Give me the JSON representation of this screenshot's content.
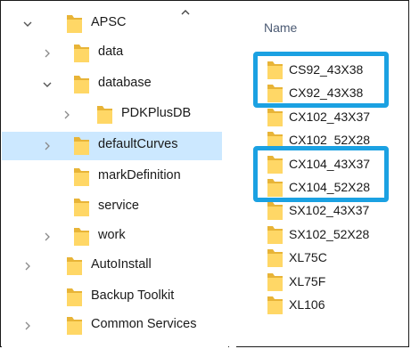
{
  "nav": {
    "items": [
      {
        "label": "APSC",
        "indent": 0,
        "chevron": "expanded",
        "selected": false
      },
      {
        "label": "data",
        "indent": 1,
        "chevron": "collapsed",
        "selected": false
      },
      {
        "label": "database",
        "indent": 1,
        "chevron": "expanded",
        "selected": false
      },
      {
        "label": "PDKPlusDB",
        "indent": 2,
        "chevron": "collapsed",
        "selected": false
      },
      {
        "label": "defaultCurves",
        "indent": 1,
        "chevron": "collapsed",
        "selected": true
      },
      {
        "label": "markDefinition",
        "indent": 1,
        "chevron": "none",
        "selected": false
      },
      {
        "label": "service",
        "indent": 1,
        "chevron": "none",
        "selected": false
      },
      {
        "label": "work",
        "indent": 1,
        "chevron": "collapsed",
        "selected": false
      },
      {
        "label": "AutoInstall",
        "indent": 0,
        "chevron": "collapsed",
        "selected": false
      },
      {
        "label": "Backup Toolkit",
        "indent": 0,
        "chevron": "none",
        "selected": false
      },
      {
        "label": "Common Services",
        "indent": 0,
        "chevron": "collapsed",
        "selected": false
      }
    ],
    "scroll_up_icon": "chevron-up-icon"
  },
  "content": {
    "column_header": "Name",
    "files": [
      {
        "label": "CS92_43X38"
      },
      {
        "label": "CX92_43X38"
      },
      {
        "label": "CX102_43X37"
      },
      {
        "label": "CX102_52X28"
      },
      {
        "label": "CX104_43X37"
      },
      {
        "label": "CX104_52X28"
      },
      {
        "label": "SX102_43X37"
      },
      {
        "label": "SX102_52X28"
      },
      {
        "label": "XL75C"
      },
      {
        "label": "XL75F"
      },
      {
        "label": "XL106"
      }
    ]
  },
  "colors": {
    "selection": "#cce8ff",
    "highlight_box": "#1ba1e2",
    "folder_fill": "#ffd766",
    "folder_back": "#e8b437"
  }
}
